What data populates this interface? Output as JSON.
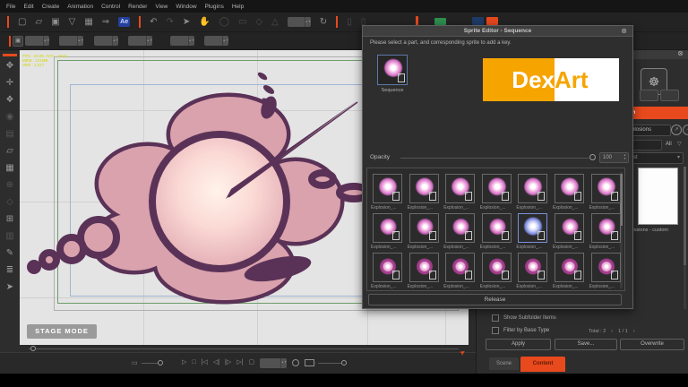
{
  "accent": "#e8491d",
  "menu_bar": {
    "items": [
      "File",
      "Edit",
      "Create",
      "Animation",
      "Control",
      "Render",
      "View",
      "Window",
      "Plugins",
      "Help"
    ]
  },
  "toolbar": {
    "icons": [
      {
        "divider": true
      },
      {
        "name": "new-file-icon",
        "glyph": "▢"
      },
      {
        "name": "open-file-icon",
        "glyph": "▱"
      },
      {
        "name": "save-icon",
        "glyph": "▣"
      },
      {
        "name": "basket-icon",
        "glyph": "▽"
      },
      {
        "name": "image-icon",
        "glyph": "▦"
      },
      {
        "name": "export-icon",
        "glyph": "⇒"
      },
      {
        "name": "after-effects-badge",
        "glyph": "Ae",
        "badge": true
      },
      {
        "divider": true
      },
      {
        "name": "undo-icon",
        "glyph": "↶"
      },
      {
        "name": "redo-icon",
        "glyph": "↷",
        "dim": true
      },
      {
        "name": "pointer-icon",
        "glyph": "➤"
      },
      {
        "name": "hand-icon",
        "glyph": "✋",
        "dim": true
      },
      {
        "name": "zoom-icon",
        "glyph": "◯",
        "dim": true
      },
      {
        "name": "flip-icon",
        "glyph": "▭",
        "dim": true
      },
      {
        "name": "mirror-icon",
        "glyph": "◇",
        "dim": true
      },
      {
        "name": "angle-icon",
        "glyph": "△",
        "dim": true
      },
      {
        "kind": "field"
      },
      {
        "name": "reset-rotation-icon",
        "glyph": "↻"
      },
      {
        "divider": true
      },
      {
        "name": "extra-icon-1",
        "glyph": "▯",
        "dim": true
      },
      {
        "name": "extra-icon-2",
        "glyph": "▯",
        "dim": true
      }
    ],
    "fields": [
      "",
      "",
      "",
      "",
      "",
      ""
    ]
  },
  "left_toolbar": {
    "tools": [
      {
        "name": "walk-tool-icon",
        "glyph": "✥"
      },
      {
        "name": "pose-tool-icon",
        "glyph": "✛"
      },
      {
        "name": "rig-tool-icon",
        "glyph": "❖"
      },
      {
        "name": "record-icon",
        "glyph": "◉",
        "dim": true
      },
      {
        "name": "camera-tool-icon",
        "glyph": "▤",
        "dim": true
      },
      {
        "name": "folder-tool-icon",
        "glyph": "▱"
      },
      {
        "name": "sheet-tool-icon",
        "glyph": "▦"
      },
      {
        "name": "pin-tool-icon",
        "glyph": "⊕",
        "dim": true
      },
      {
        "name": "marker-tool-icon",
        "glyph": "◇",
        "dim": true
      },
      {
        "name": "select-rect-tool-icon",
        "glyph": "⊞"
      },
      {
        "name": "grid-tool-icon",
        "glyph": "▥",
        "dim": true
      },
      {
        "name": "pen-tool-icon",
        "glyph": "✎"
      },
      {
        "name": "ruler-tool-icon",
        "glyph": "≣"
      },
      {
        "name": "arrow-tool-icon",
        "glyph": "➤"
      }
    ]
  },
  "canvas": {
    "debug": [
      "FPS : 23.09, AVG : 18.81",
      "MEM : 141MB",
      "VER : 1.217"
    ],
    "stage_mode": "STAGE MODE",
    "colors": {
      "outline": "#5b3257",
      "body": "#d9a2ad",
      "glow": "#fff0e8",
      "frame_green": "#6f9e6a",
      "guide_blue": "#9fb6d4"
    }
  },
  "dialog": {
    "title": "Sprite Editor - Sequence",
    "close_glyph": "⊗",
    "instruction": "Please select a part, and corresponding sprite to add a key.",
    "selected_label": "Sequence",
    "logo": {
      "left": "Dex",
      "right": "Art",
      "orange": "#f6a400"
    },
    "opacity": {
      "label": "Opacity",
      "value": "100"
    },
    "grid": {
      "selected_color": "#7b8fd8",
      "items": [
        {
          "label": "Explosion_...",
          "variant": "burst"
        },
        {
          "label": "Explosion_...",
          "variant": "burst"
        },
        {
          "label": "Explosion_...",
          "variant": "burst"
        },
        {
          "label": "Explosion_...",
          "variant": "burst"
        },
        {
          "label": "Explosion_...",
          "variant": "burst"
        },
        {
          "label": "Explosion_...",
          "variant": "burst"
        },
        {
          "label": "Explosion_...",
          "variant": "burst"
        },
        {
          "label": "Explosion_...",
          "variant": "puff"
        },
        {
          "label": "Explosion_...",
          "variant": "puff"
        },
        {
          "label": "Explosion_...",
          "variant": "puff"
        },
        {
          "label": "Explosion_...",
          "variant": "puff"
        },
        {
          "label": "Explosion_...",
          "variant": "puff",
          "selected": true
        },
        {
          "label": "Explosion_...",
          "variant": "puff"
        },
        {
          "label": "Explosion_...",
          "variant": "puff"
        },
        {
          "label": "Explosion_...",
          "variant": "swirl"
        },
        {
          "label": "Explosion_...",
          "variant": "swirl"
        },
        {
          "label": "Explosion_...",
          "variant": "swirl"
        },
        {
          "label": "Explosion_...",
          "variant": "swirl"
        },
        {
          "label": "Explosion_...",
          "variant": "swirl"
        },
        {
          "label": "Explosion_...",
          "variant": "swirl"
        },
        {
          "label": "Explosion_...",
          "variant": "swirl"
        }
      ]
    },
    "release_label": "Release"
  },
  "right_panel": {
    "close_glyph": "⊗",
    "palette_glyph": "☸",
    "item_button_label": "Item",
    "search_value": "Explosions",
    "icon1_glyph": "↗",
    "icon2_glyph": "−",
    "all_label": "All",
    "filter_glyph": "▽",
    "dropdown_value": "First",
    "dropdown_caret": "▾",
    "custom_label": "Explosions - custom",
    "checkbox1": "Show Subfolder Items",
    "checkbox2": "Filter by Base Type",
    "total": "Total : 2",
    "page_prev": "‹",
    "page": "1 / 1",
    "page_next": "›",
    "apply": "Apply",
    "save": "Save...",
    "overwrite": "Overwrite",
    "tab_scene": "Scene",
    "tab_content": "Content"
  },
  "playback": {
    "buttons": [
      {
        "name": "play-button",
        "glyph": "▷"
      },
      {
        "name": "stop-button",
        "glyph": "□"
      },
      {
        "name": "jump-start-button",
        "glyph": "|◁"
      },
      {
        "name": "step-back-button",
        "glyph": "◁|"
      },
      {
        "name": "step-forward-button",
        "glyph": "|▷"
      },
      {
        "name": "jump-end-button",
        "glyph": "▷|"
      },
      {
        "name": "loop-button",
        "glyph": "▢"
      },
      {
        "kind": "field"
      },
      {
        "name": "keyframe-button",
        "kind": "circle"
      },
      {
        "name": "onion-skin-button",
        "kind": "rect"
      }
    ],
    "frame_value": ""
  }
}
